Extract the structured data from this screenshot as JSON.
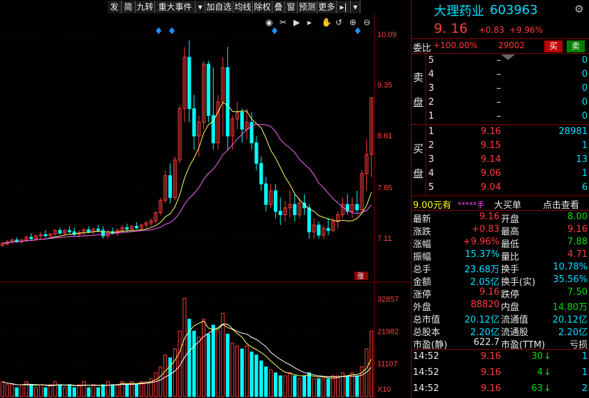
{
  "toolbar": {
    "items": [
      "发",
      "简",
      "九转",
      "重大事件",
      "▾",
      "加自选",
      "均线",
      "除权",
      "叠",
      "窗",
      "预测",
      "更多",
      "▸|",
      "▾"
    ]
  },
  "chart": {
    "price_ticks": [
      "10.09",
      "9.35",
      "8.61",
      "7.85",
      "7.11"
    ],
    "volume_ticks": [
      "32857",
      "21982",
      "11107"
    ],
    "volume_unit": "X10",
    "limit_badge": "涨",
    "icons": [
      "eye-icon",
      "scissors-icon",
      "play-icon",
      "forward-icon",
      "hand-icon",
      "undo-icon",
      "zoom-in-icon",
      "zoom-out-icon"
    ]
  },
  "chart_data": {
    "type": "candlestick",
    "price_range": [
      6.7,
      10.2
    ],
    "candles": [
      [
        7.0,
        7.05,
        6.98,
        7.03
      ],
      [
        7.02,
        7.08,
        7.0,
        7.05
      ],
      [
        7.05,
        7.1,
        7.03,
        7.08
      ],
      [
        7.08,
        7.12,
        7.04,
        7.06
      ],
      [
        7.06,
        7.1,
        7.02,
        7.08
      ],
      [
        7.08,
        7.15,
        7.06,
        7.12
      ],
      [
        7.12,
        7.18,
        7.08,
        7.1
      ],
      [
        7.1,
        7.16,
        7.07,
        7.14
      ],
      [
        7.14,
        7.2,
        7.1,
        7.16
      ],
      [
        7.16,
        7.22,
        7.12,
        7.14
      ],
      [
        7.14,
        7.18,
        7.1,
        7.17
      ],
      [
        7.17,
        7.24,
        7.14,
        7.22
      ],
      [
        7.22,
        7.26,
        7.16,
        7.18
      ],
      [
        7.18,
        7.24,
        7.15,
        7.22
      ],
      [
        7.22,
        7.28,
        7.18,
        7.2
      ],
      [
        7.2,
        7.26,
        7.14,
        7.16
      ],
      [
        7.16,
        7.22,
        7.12,
        7.19
      ],
      [
        7.19,
        7.25,
        7.15,
        7.23
      ],
      [
        7.23,
        7.28,
        7.18,
        7.2
      ],
      [
        7.2,
        7.26,
        7.16,
        7.24
      ],
      [
        7.24,
        7.3,
        7.2,
        7.22
      ],
      [
        7.22,
        7.28,
        7.1,
        7.14
      ],
      [
        7.14,
        7.22,
        7.1,
        7.2
      ],
      [
        7.2,
        7.26,
        7.16,
        7.18
      ],
      [
        7.18,
        7.25,
        7.14,
        7.22
      ],
      [
        7.22,
        7.3,
        7.18,
        7.26
      ],
      [
        7.26,
        7.32,
        7.2,
        7.24
      ],
      [
        7.24,
        7.3,
        7.22,
        7.28
      ],
      [
        7.28,
        7.34,
        7.24,
        7.26
      ],
      [
        7.26,
        7.32,
        7.22,
        7.3
      ],
      [
        7.3,
        7.36,
        7.26,
        7.33
      ],
      [
        7.33,
        7.4,
        7.28,
        7.36
      ],
      [
        7.36,
        7.5,
        7.32,
        7.48
      ],
      [
        7.48,
        7.7,
        7.44,
        7.66
      ],
      [
        7.66,
        8.1,
        7.62,
        8.02
      ],
      [
        8.02,
        8.2,
        7.62,
        7.7
      ],
      [
        7.7,
        8.3,
        7.66,
        8.25
      ],
      [
        8.25,
        9.05,
        8.2,
        9.0
      ],
      [
        9.0,
        9.9,
        8.8,
        9.75
      ],
      [
        9.75,
        10.0,
        8.8,
        9.0
      ],
      [
        9.0,
        9.2,
        8.4,
        8.6
      ],
      [
        8.6,
        8.9,
        8.3,
        8.8
      ],
      [
        8.8,
        9.7,
        8.7,
        9.65
      ],
      [
        9.65,
        9.7,
        8.8,
        8.9
      ],
      [
        8.9,
        9.6,
        8.4,
        8.5
      ],
      [
        8.5,
        9.2,
        8.4,
        9.1
      ],
      [
        9.1,
        9.75,
        8.6,
        9.6
      ],
      [
        9.6,
        9.9,
        8.4,
        8.6
      ],
      [
        8.6,
        8.9,
        8.4,
        8.85
      ],
      [
        8.85,
        9.1,
        8.7,
        8.95
      ],
      [
        8.95,
        9.0,
        8.5,
        8.7
      ],
      [
        8.7,
        9.0,
        8.55,
        8.8
      ],
      [
        8.8,
        8.95,
        8.4,
        8.5
      ],
      [
        8.5,
        8.6,
        8.1,
        8.2
      ],
      [
        8.2,
        8.3,
        7.8,
        7.9
      ],
      [
        7.9,
        8.0,
        7.5,
        7.6
      ],
      [
        7.6,
        7.9,
        7.55,
        7.8
      ],
      [
        7.8,
        7.9,
        7.4,
        7.5
      ],
      [
        7.5,
        7.7,
        7.3,
        7.45
      ],
      [
        7.45,
        7.65,
        7.35,
        7.55
      ],
      [
        7.55,
        7.8,
        7.4,
        7.6
      ],
      [
        7.6,
        7.75,
        7.35,
        7.45
      ],
      [
        7.45,
        7.7,
        7.4,
        7.62
      ],
      [
        7.62,
        7.75,
        7.45,
        7.55
      ],
      [
        7.55,
        7.6,
        7.1,
        7.2
      ],
      [
        7.2,
        7.4,
        7.1,
        7.3
      ],
      [
        7.3,
        7.35,
        7.1,
        7.15
      ],
      [
        7.15,
        7.3,
        7.1,
        7.25
      ],
      [
        7.25,
        7.4,
        7.15,
        7.22
      ],
      [
        7.22,
        7.4,
        7.2,
        7.35
      ],
      [
        7.35,
        7.5,
        7.25,
        7.45
      ],
      [
        7.45,
        7.7,
        7.4,
        7.6
      ],
      [
        7.6,
        7.75,
        7.45,
        7.5
      ],
      [
        7.5,
        7.7,
        7.4,
        7.6
      ],
      [
        7.6,
        7.8,
        7.48,
        7.52
      ],
      [
        7.52,
        8.1,
        7.48,
        8.05
      ],
      [
        8.05,
        8.55,
        7.8,
        8.33
      ],
      [
        8.33,
        9.16,
        8.0,
        9.16
      ]
    ],
    "volume": [
      5,
      4,
      4,
      3,
      4,
      5,
      4,
      3,
      4,
      3,
      4,
      5,
      4,
      3,
      4,
      3,
      4,
      5,
      3,
      4,
      3,
      4,
      5,
      4,
      4,
      5,
      4,
      5,
      4,
      5,
      5,
      6,
      8,
      10,
      14,
      13,
      16,
      22,
      33,
      26,
      22,
      20,
      26,
      21,
      24,
      22,
      28,
      21,
      18,
      17,
      16,
      17,
      15,
      14,
      12,
      10,
      9,
      8,
      7,
      7,
      8,
      7,
      6,
      7,
      8,
      6,
      6,
      6,
      6,
      7,
      7,
      8,
      7,
      8,
      7,
      10,
      16,
      22
    ]
  },
  "stock": {
    "name": "大理药业",
    "code": "603963",
    "price": "9. 16",
    "change": "+0.83",
    "change_pct": "+9.96%",
    "weibi_label": "委比",
    "weibi_value": "+100.00%",
    "weicha_value": "29002",
    "buy_label": "买",
    "sell_label": "卖"
  },
  "asks": {
    "label_top": "卖",
    "label_bottom": "盘",
    "rows": [
      {
        "level": "5",
        "price": "–",
        "vol": "0"
      },
      {
        "level": "4",
        "price": "–",
        "vol": "0"
      },
      {
        "level": "3",
        "price": "–",
        "vol": "0"
      },
      {
        "level": "2",
        "price": "–",
        "vol": "0"
      },
      {
        "level": "1",
        "price": "–",
        "vol": "0"
      }
    ]
  },
  "bids": {
    "label_top": "买",
    "label_bottom": "盘",
    "rows": [
      {
        "level": "1",
        "price": "9.16",
        "vol": "28981"
      },
      {
        "level": "2",
        "price": "9.15",
        "vol": "1"
      },
      {
        "level": "3",
        "price": "9.14",
        "vol": "13"
      },
      {
        "level": "4",
        "price": "9.06",
        "vol": "1"
      },
      {
        "level": "5",
        "price": "9.04",
        "vol": "6"
      }
    ]
  },
  "big_order": {
    "price_text": "9.00元有",
    "stars": "*****手",
    "label": "大买单",
    "link": "点击查看"
  },
  "stats": [
    {
      "l1": "最新",
      "v1": "9.16",
      "c1": "red",
      "l2": "开盘",
      "v2": "8.00",
      "c2": "grn"
    },
    {
      "l1": "涨跌",
      "v1": "+0.83",
      "c1": "red",
      "l2": "最高",
      "v2": "9.16",
      "c2": "red"
    },
    {
      "l1": "涨幅",
      "v1": "+9.96%",
      "c1": "red",
      "l2": "最低",
      "v2": "7.88",
      "c2": "grn"
    },
    {
      "l1": "振幅",
      "v1": "15.37%",
      "c1": "cyan",
      "l2": "量比",
      "v2": "4.71",
      "c2": "red"
    },
    {
      "l1": "总手",
      "v1": "23.68万",
      "c1": "cyan",
      "l2": "换手",
      "v2": "10.78%",
      "c2": "cyan"
    },
    {
      "l1": "金额",
      "v1": "2.05亿",
      "c1": "cyan",
      "l2": "换手(实)",
      "v2": "35.56%",
      "c2": "cyan"
    },
    {
      "l1": "涨停",
      "v1": "9.16",
      "c1": "red",
      "l2": "跌停",
      "v2": "7.50",
      "c2": "grn"
    },
    {
      "l1": "外盘",
      "v1": "88820",
      "c1": "red",
      "l2": "内盘",
      "v2": "14.80万",
      "c2": "grn"
    },
    {
      "l1": "总市值",
      "v1": "20.12亿",
      "c1": "cyan",
      "l2": "流通值",
      "v2": "20.12亿",
      "c2": "cyan"
    },
    {
      "l1": "总股本",
      "v1": "2.20亿",
      "c1": "cyan",
      "l2": "流通股",
      "v2": "2.20亿",
      "c2": "cyan"
    },
    {
      "l1": "市盈(静)",
      "v1": "622.7",
      "c1": "wht",
      "l2": "市盈(TTM)",
      "v2": "亏损",
      "c2": "wht"
    }
  ],
  "ticks": [
    {
      "time": "14:52",
      "price": "9.16",
      "vol": "30",
      "dir": "down",
      "count": "1"
    },
    {
      "time": "14:52",
      "price": "9.16",
      "vol": "4",
      "dir": "down",
      "count": "1"
    },
    {
      "time": "14:52",
      "price": "9.16",
      "vol": "63",
      "dir": "down",
      "count": "2"
    }
  ]
}
